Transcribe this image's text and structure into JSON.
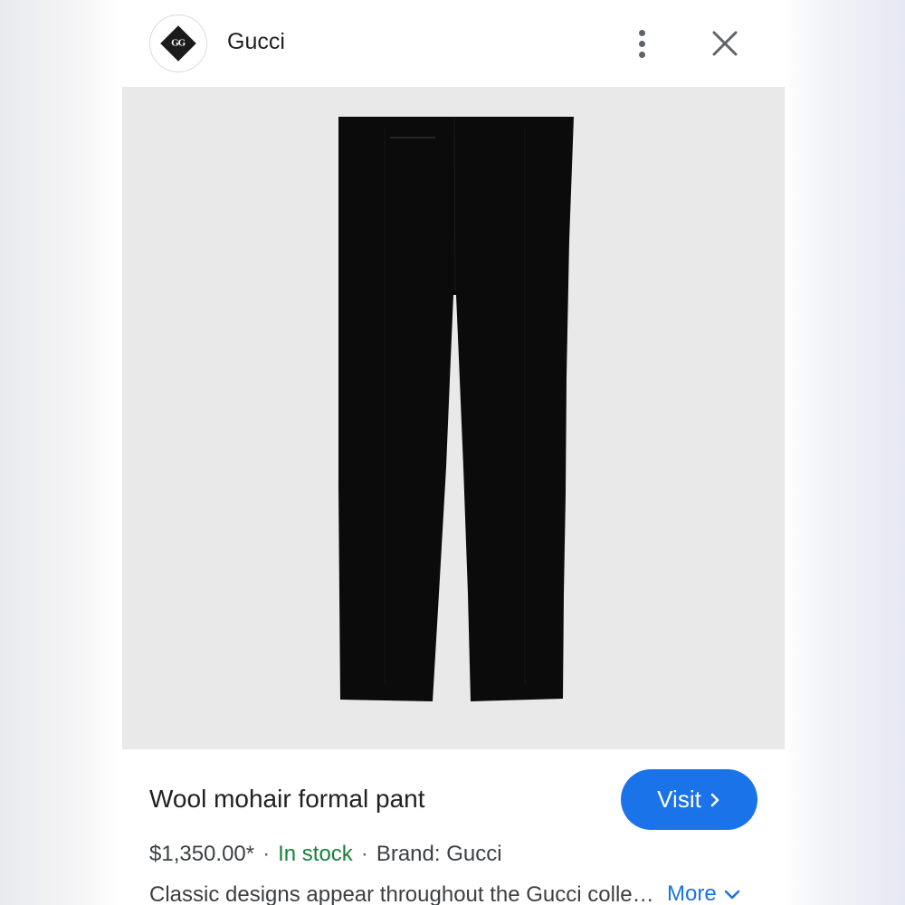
{
  "header": {
    "brand": "Gucci",
    "logo_text": "GG",
    "logo_icon": "gucci-logo-icon",
    "more_icon": "more-vert-icon",
    "close_icon": "close-icon"
  },
  "product": {
    "image_icon": "product-image-black-trousers",
    "title": "Wool mohair formal pant",
    "visit_label": "Visit",
    "price": "$1,350.00*",
    "separator": "·",
    "stock": "In stock",
    "brand_label": "Brand: Gucci",
    "description": "Classic designs appear throughout the Gucci collections and this season is no exception.",
    "more_label": "More"
  },
  "colors": {
    "accent": "#1a73e8",
    "stock_green": "#188038",
    "image_background": "#e9e9ea",
    "product_black": "#0b0b0b"
  }
}
